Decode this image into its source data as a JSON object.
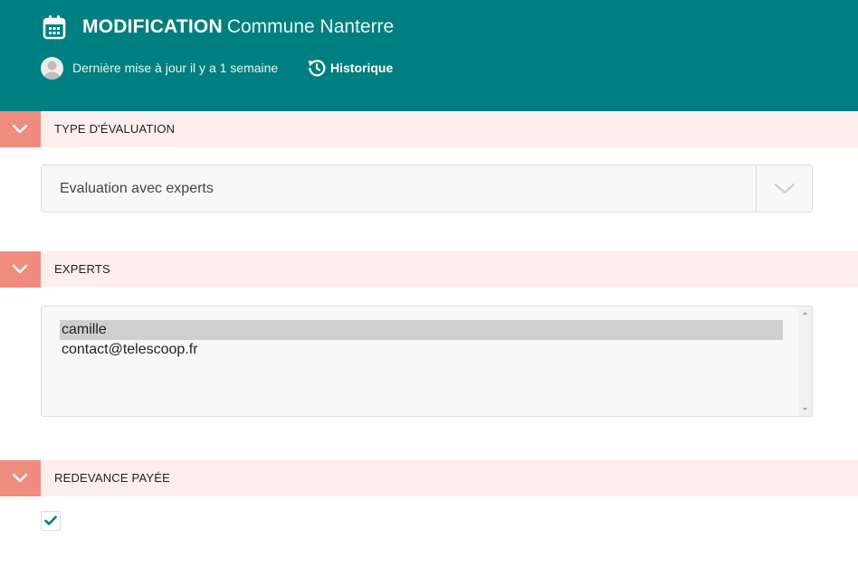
{
  "header": {
    "title_strong": "MODIFICATION",
    "title_light": "Commune Nanterre",
    "last_update": "Dernière mise à jour il y a 1 semaine",
    "history_link": "Historique",
    "background_color": "#007f80"
  },
  "sections": {
    "type_evaluation": {
      "label": "TYPE D'ÉVALUATION",
      "select_value": "Evaluation avec experts"
    },
    "experts": {
      "label": "EXPERTS",
      "options": [
        "camille",
        "contact@telescoop.fr"
      ],
      "selected": "camille"
    },
    "redevance": {
      "label": "REDEVANCE PAYÉE",
      "checked": true
    }
  },
  "colors": {
    "section_toggle": "#f08b80",
    "section_band": "#fdeeec",
    "check_mark": "#007f80"
  }
}
